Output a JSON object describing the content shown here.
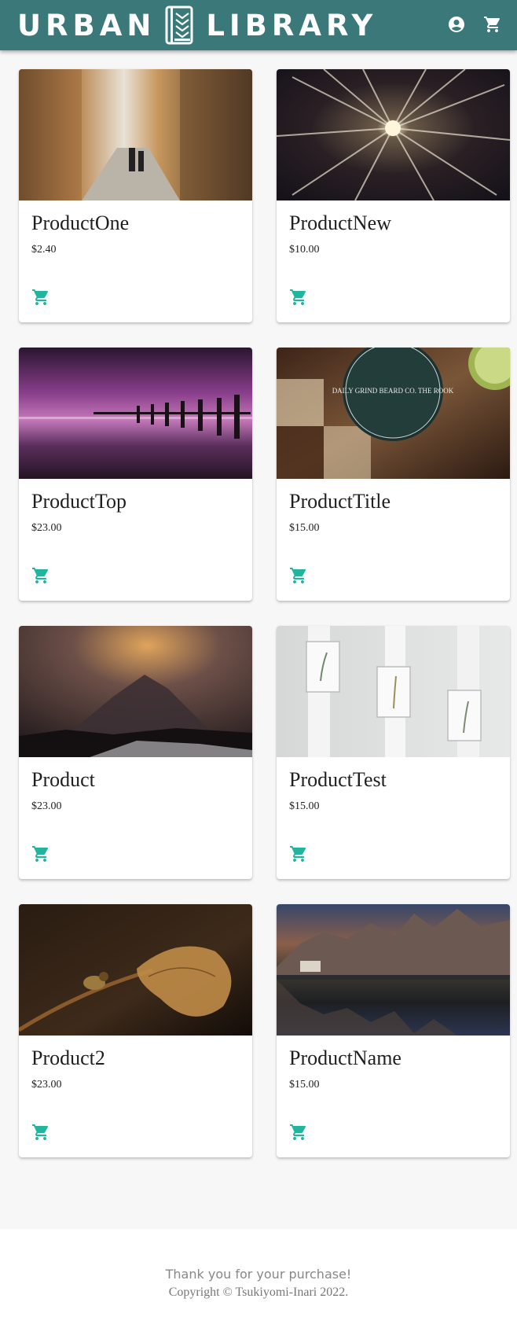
{
  "header": {
    "brand_left": "URBAN",
    "brand_right": "LIBRARY",
    "logo_icon": "book-icon",
    "account_icon": "account-circle-icon",
    "cart_icon": "shopping-cart-icon"
  },
  "colors": {
    "header_bg": "#3a7879",
    "accent": "#21b59e",
    "page_bg": "#f7f7f7"
  },
  "products": [
    {
      "name": "ProductOne",
      "price": "$2.40",
      "image": "narrow alley street photo",
      "cart_icon": "add-to-cart-icon"
    },
    {
      "name": "ProductNew",
      "price": "$10.00",
      "image": "radial ceiling lights photo",
      "cart_icon": "add-to-cart-icon"
    },
    {
      "name": "ProductTop",
      "price": "$23.00",
      "image": "purple sunset pier photo",
      "cart_icon": "add-to-cart-icon"
    },
    {
      "name": "ProductTitle",
      "price": "$15.00",
      "image": "beard balm tin on chessboard photo",
      "image_text": "DAILY GRIND BEARD CO. THE ROOK",
      "cart_icon": "add-to-cart-icon"
    },
    {
      "name": "Product",
      "price": "$23.00",
      "image": "misty mountain photo",
      "cart_icon": "add-to-cart-icon"
    },
    {
      "name": "ProductTest",
      "price": "$15.00",
      "image": "framed botanical prints photo",
      "cart_icon": "add-to-cart-icon"
    },
    {
      "name": "Product2",
      "price": "$23.00",
      "image": "insect on dried leaf macro photo",
      "cart_icon": "add-to-cart-icon"
    },
    {
      "name": "ProductName",
      "price": "$15.00",
      "image": "mountain lake reflection photo",
      "cart_icon": "add-to-cart-icon"
    }
  ],
  "footer": {
    "thanks": "Thank you for your purchase!",
    "copyright": "Copyright © Tsukiyomi-Inari 2022."
  }
}
